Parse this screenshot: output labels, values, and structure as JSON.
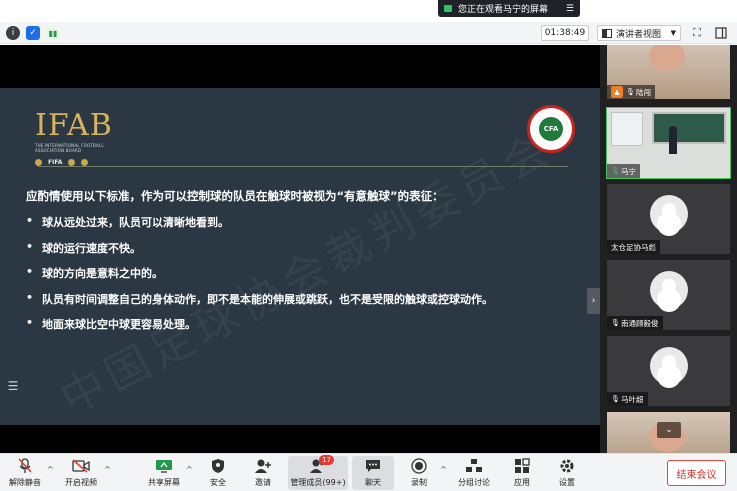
{
  "share_banner": {
    "text": "您正在观看马宁的屏幕",
    "menu_icon": "menu-icon"
  },
  "top_bar": {
    "info_icon": "i",
    "timer": "01:38:49",
    "view_mode": "演讲者视图"
  },
  "slide": {
    "logo_text": "IFAB",
    "logo_sub": "THE INTERNATIONAL FOOTBALL ASSOCIATION BOARD",
    "logo_fifa": "FIFA",
    "cfa_text": "CFA",
    "heading": "应酌情使用以下标准，作为可以控制球的队员在触球时被视为“有意触球”的表征：",
    "bullets": [
      "球从远处过来，队员可以清晰地看到。",
      "球的运行速度不快。",
      "球的方向是意料之中的。",
      "队员有时间调整自己的身体动作，即不是本能的伸展或跳跃，也不是受限的触球或控球动作。",
      "地面来球比空中球更容易处理。"
    ],
    "bullet_char": "•",
    "watermark": "中国足球协会裁判委员会"
  },
  "participants": [
    {
      "name": "陆闯"
    },
    {
      "name": "马宁"
    },
    {
      "name": "太仓足协马彪"
    },
    {
      "name": "南通顾毅俊"
    },
    {
      "name": "马叶超"
    }
  ],
  "toolbar": {
    "unmute": "解除静音",
    "start_video": "开启视频",
    "share_screen": "共享屏幕",
    "security": "安全",
    "invite": "邀请",
    "manage_members": "管理成员(99+)",
    "member_badge": "17",
    "chat": "聊天",
    "record": "录制",
    "breakout": "分组讨论",
    "apps": "应用",
    "settings": "设置",
    "end_meeting": "结束会议"
  },
  "colors": {
    "slide_bg": "#2b3843",
    "active_tile": "#3ec760",
    "end_button": "#d7322b",
    "badge": "#e53a2f"
  }
}
